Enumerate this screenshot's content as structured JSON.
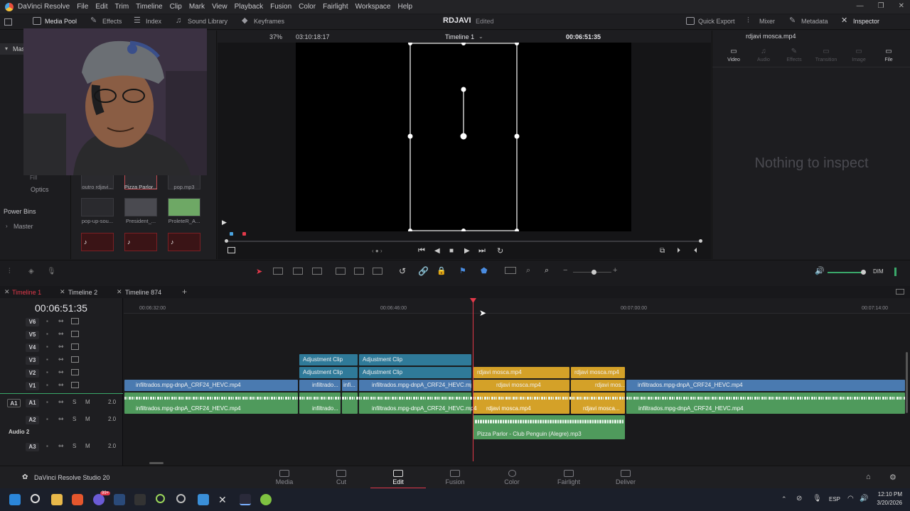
{
  "app": {
    "title": "DaVinci Resolve",
    "project_name": "RDJAVI",
    "project_status": "Edited",
    "studio_label": "DaVinci Resolve Studio 20"
  },
  "menu": [
    "File",
    "Edit",
    "Trim",
    "Timeline",
    "Clip",
    "Mark",
    "View",
    "Playback",
    "Fusion",
    "Color",
    "Fairlight",
    "Workspace",
    "Help"
  ],
  "toolbar": {
    "left": [
      {
        "label": "Media Pool"
      },
      {
        "label": "Effects"
      },
      {
        "label": "Index"
      },
      {
        "label": "Sound Library"
      }
    ],
    "keyframes": "Keyframes",
    "right": [
      {
        "label": "Quick Export"
      },
      {
        "label": "Mixer"
      },
      {
        "label": "Metadata"
      },
      {
        "label": "Inspector"
      }
    ]
  },
  "media_pool": {
    "master_label": "Mas",
    "fx_labels": [
      "Fill",
      "Optics"
    ],
    "power_bins": "Power Bins",
    "master": "Master",
    "clips": [
      {
        "label": "outro rdjavi..."
      },
      {
        "label": "Pizza Parlor..."
      },
      {
        "label": "pop.mp3"
      },
      {
        "label": "pop-up-sou..."
      },
      {
        "label": "President_..."
      },
      {
        "label": "ProleteR_A..."
      }
    ]
  },
  "viewer": {
    "zoom": "37%",
    "source_tc": "03:10:18:17",
    "timeline_name": "Timeline 1",
    "record_tc": "00:06:51:35"
  },
  "inspector": {
    "clip_name": "rdjavi mosca.mp4",
    "tabs": [
      "Video",
      "Audio",
      "Effects",
      "Transition",
      "Image",
      "File"
    ],
    "empty_text": "Nothing to inspect"
  },
  "timeline_tabs": [
    "Timeline 1",
    "Timeline 2",
    "Timeline 874"
  ],
  "timecode": "00:06:51:35",
  "ruler": [
    "00:06:32:00",
    "00:06:46:00",
    "00:07:00:00",
    "00:07:14:00"
  ],
  "dim_label": "DIM",
  "tracks": {
    "video": [
      "V6",
      "V5",
      "V4",
      "V3",
      "V2",
      "V1"
    ],
    "audio": [
      {
        "id": "A1",
        "level": "2.0"
      },
      {
        "id": "A2",
        "level": "2.0",
        "name": "Audio 2"
      },
      {
        "id": "A3",
        "level": "2.0"
      }
    ],
    "solo": "S",
    "mute": "M"
  },
  "clips": {
    "adjustment": "Adjustment Clip",
    "infiltrados": "infiltrados.mpg-dnpA_CRF24_HEVC.mp4",
    "infil_short": "infiltrado...",
    "infi": "infi...",
    "mosca": "rdjavi mosca.mp4",
    "mosca_short": "rdjavi mos...",
    "mosca_short2": "rdjavi mosca...",
    "pizza": "Pizza Parlor - Club Penguin (Alegre).mp3"
  },
  "pages": [
    "Media",
    "Cut",
    "Edit",
    "Fusion",
    "Color",
    "Fairlight",
    "Deliver"
  ],
  "taskbar": {
    "lang": "ESP",
    "time": "12:10 PM",
    "date": "3/20/2026",
    "badge": "99+"
  },
  "colors": {
    "accent": "#e3394a",
    "clip_blue": "#4a7ab0",
    "clip_gold": "#d4a128",
    "clip_green": "#4f9a5c"
  }
}
